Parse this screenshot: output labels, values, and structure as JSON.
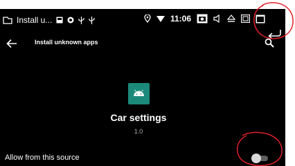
{
  "status_bar": {
    "notification_title": "Install u...",
    "time": "11:06",
    "icons": [
      "image-icon",
      "shield-icon",
      "usb-icon",
      "usb-icon",
      "location-icon",
      "wifi-icon",
      "screenshot-icon",
      "volume-icon",
      "eject-icon",
      "picture-icon",
      "window-icon"
    ]
  },
  "app_bar": {
    "title": "Install unknown apps",
    "back_icon": "arrow-left-icon",
    "search_icon": "search-icon"
  },
  "app": {
    "name": "Car settings",
    "version": "1.0",
    "icon": "android-icon",
    "icon_color": "#1b8a7a"
  },
  "setting": {
    "label": "Allow from this source",
    "enabled": false
  },
  "nav": {
    "top_back_icon": "return-arrow-icon"
  },
  "annotation_color": "#e0202a"
}
